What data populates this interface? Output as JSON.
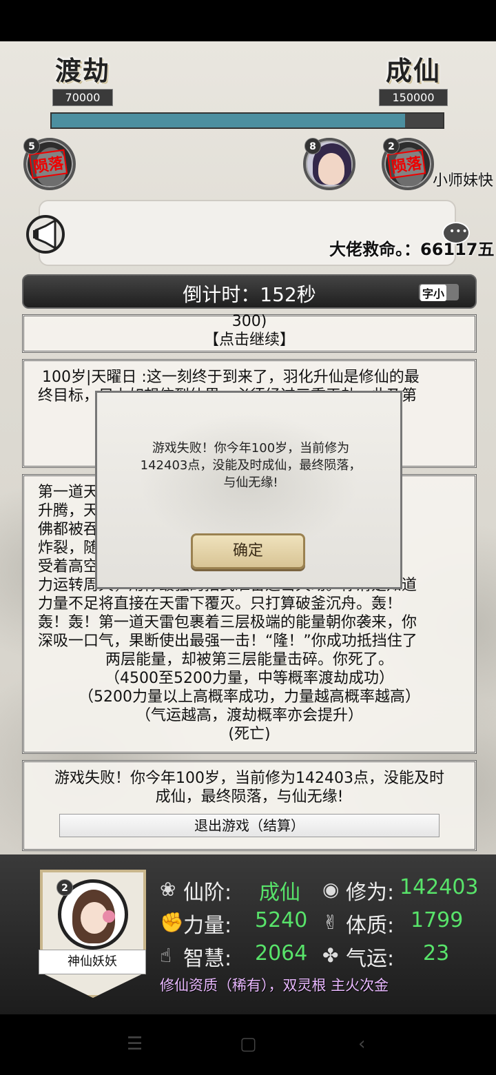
{
  "progress": {
    "left_title": "渡劫",
    "left_value": "70000",
    "right_title": "成仙",
    "right_value": "150000",
    "fill_fraction": 0.904
  },
  "npcs": [
    {
      "badge": "5",
      "stamp": "陨落"
    },
    {
      "badge": "8"
    },
    {
      "badge": "2",
      "stamp": "陨落",
      "name": "小师妹快"
    }
  ],
  "chat": {
    "message": "大佬救命。：66117五",
    "bubble": "•••"
  },
  "timer": {
    "text": "倒计时：152秒",
    "toggle_label": "字小"
  },
  "story": {
    "card1_line1": "300)",
    "card1_line2": "【点击继续】",
    "card2_line1": "100岁|天曜日 :这一刻终于到来了，羽化升仙是修仙的最",
    "card2_line2": "终目标，只上如想信到仙界，必须经过三重天劫，此乃第",
    "card3_lines": [
      "第一道天雷就已经惊天动地。空中的乌云开始不断",
      "升腾，天地间一片黑暗，似乎连月亮的光芒仿",
      "佛都被吞噬，天雷滚滚，道道闪电撕裂在云层",
      "炸裂，随后一道雷电劈向你所在之处！你感",
      "受着高空中传来的威压，心神震动。你将灵",
      "力运转周天，用你最强的招式准备迎击天劫。你清楚知道",
      "力量不足将直接在天雷下覆灭。只打算破釜沉舟。轰！",
      "轰！轰！第一道天雷包裹着三层极端的能量朝你袭来，你",
      "深吸一口气，果断使出最强一击！“隆！”你成功抵挡住了",
      "两层能量，却被第三层能量击碎。你死了。",
      "（4500至5200力量，中等概率渡劫成功）",
      "（5200力量以上高概率成功，力量越高概率越高）",
      "（气运越高，渡劫概率亦会提升）",
      "(死亡)"
    ],
    "card4_line1": "游戏失败！你今年100岁，当前修为142403点，没能及时",
    "card4_line2": "成仙，最终陨落，与仙无缘!",
    "exit_label": "退出游戏（结算）"
  },
  "modal": {
    "line1": "游戏失败！你今年100岁，当前修为",
    "line2": "142403点，没能及时成仙，最终陨落，",
    "line3": "与仙无缘!",
    "confirm": "确定"
  },
  "player": {
    "level_badge": "2",
    "name": "神仙妖妖",
    "stats": {
      "rank_label": "仙阶:",
      "rank_value": "成仙",
      "cultivation_label": "修为:",
      "cultivation_value": "142403",
      "strength_label": "力量:",
      "strength_value": "5240",
      "physique_label": "体质:",
      "physique_value": "1799",
      "wisdom_label": "智慧:",
      "wisdom_value": "2064",
      "luck_label": "气运:",
      "luck_value": "23"
    },
    "quality": "修仙资质（稀有），双灵根 主火次金"
  },
  "nav": {
    "menu": "☰",
    "home": "▢",
    "back": "‹"
  }
}
